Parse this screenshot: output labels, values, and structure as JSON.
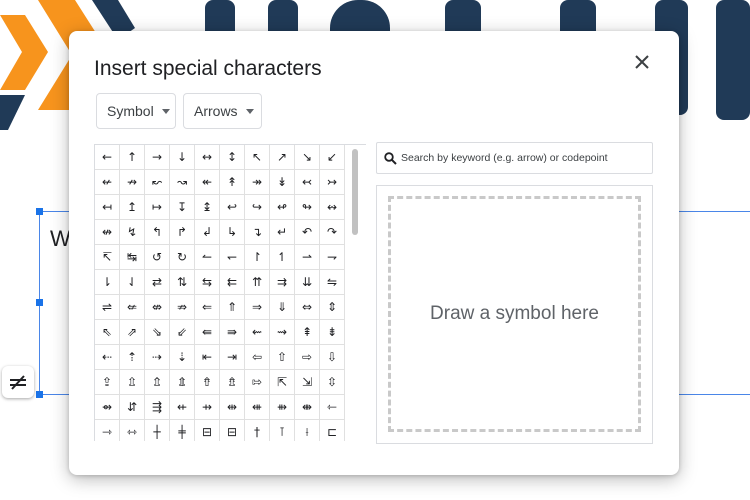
{
  "dialog": {
    "title": "Insert special characters",
    "category_dropdown": "Symbol",
    "subcategory_dropdown": "Arrows",
    "search_placeholder": "Search by keyword (e.g. arrow) or codepoint",
    "draw_area_label": "Draw a symbol here",
    "close_icon": "close-icon",
    "search_icon": "search-icon"
  },
  "document": {
    "partial_text": "W"
  },
  "symbols": [
    "←",
    "↑",
    "→",
    "↓",
    "↔",
    "↕",
    "↖",
    "↗",
    "↘",
    "↙",
    "↚",
    "↛",
    "↜",
    "↝",
    "↞",
    "↟",
    "↠",
    "↡",
    "↢",
    "↣",
    "↤",
    "↥",
    "↦",
    "↧",
    "↨",
    "↩",
    "↪",
    "↫",
    "↬",
    "↭",
    "↮",
    "↯",
    "↰",
    "↱",
    "↲",
    "↳",
    "↴",
    "↵",
    "↶",
    "↷",
    "↸",
    "↹",
    "↺",
    "↻",
    "↼",
    "↽",
    "↾",
    "↿",
    "⇀",
    "⇁",
    "⇂",
    "⇃",
    "⇄",
    "⇅",
    "⇆",
    "⇇",
    "⇈",
    "⇉",
    "⇊",
    "⇋",
    "⇌",
    "⇍",
    "⇎",
    "⇏",
    "⇐",
    "⇑",
    "⇒",
    "⇓",
    "⇔",
    "⇕",
    "⇖",
    "⇗",
    "⇘",
    "⇙",
    "⇚",
    "⇛",
    "⇜",
    "⇝",
    "⇞",
    "⇟",
    "⇠",
    "⇡",
    "⇢",
    "⇣",
    "⇤",
    "⇥",
    "⇦",
    "⇧",
    "⇨",
    "⇩",
    "⇪",
    "⇫",
    "⇬",
    "⇭",
    "⇮",
    "⇯",
    "⇰",
    "⇱",
    "⇲",
    "⇳",
    "⇴",
    "⇵",
    "⇶",
    "⇷",
    "⇸",
    "⇹",
    "⇺",
    "⇻",
    "⇼",
    "⇽",
    "⇾",
    "⇿",
    "┼",
    "╪",
    "⊟",
    "⊟",
    "†",
    "⊺",
    "⟊",
    "⊏"
  ],
  "colors": {
    "logo_orange": "#f7941d",
    "logo_navy": "#203a57",
    "selection_blue": "#4a86e8"
  }
}
